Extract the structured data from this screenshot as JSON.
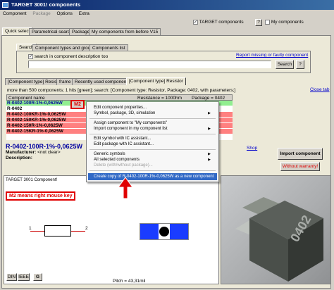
{
  "window": {
    "title": "TARGET 3001! components"
  },
  "menu": {
    "items": [
      "Component",
      "Package",
      "Options",
      "Extra"
    ]
  },
  "top_options": {
    "target_components": "TARGET components",
    "help": "?",
    "my_components": "My components"
  },
  "main_tabs": [
    "Quick select",
    "Parametrical search",
    "Package",
    "My components from before V15"
  ],
  "sub_tabs": [
    "Search",
    "Component types and groups",
    "Components list"
  ],
  "search": {
    "checkbox_label": "search in component description too",
    "report_link": "Report missing or faulty component",
    "button": "Search",
    "help": "?"
  },
  "result_tabs": [
    "[Component type] Resistor",
    "frame",
    "Recently used components",
    "[Component type] Resistor"
  ],
  "status_line": "more than 500 components; 1 hits [green]; search: [Component type: Resistor, Package: 0402, with parameters;]",
  "close_tab": "Close tab",
  "table": {
    "headers": [
      "Component name",
      "Resistance = 1000hm",
      "Package = 0402"
    ],
    "rows": [
      "R-0402-100R-1%-0,0625W",
      "R-0402",
      "R-0402-100KR-1%-0,0625W",
      "R-0402-150KR-1%-0,0625W",
      "R-0402-150R-1%-0,0625W",
      "R-0402-15KR-1%-0,0625W"
    ]
  },
  "m2_badge": "M2",
  "context_menu": {
    "items": [
      "Edit component properties...",
      "Symbol, package, 3D, simulation",
      "Assign component to \"My components\"",
      "Import component in my component list",
      "Edit symbol with IC assistant...",
      "Edit package with IC assistant...",
      "Generic symbols",
      "All selected components",
      "Delete (with/without package)...",
      "Create copy of R-0402-100R-1%-0,0625W as a new component"
    ]
  },
  "detail": {
    "name": "R-0402-100R-1%-0,0625W",
    "manufacturer_label": "Manufacturer:",
    "manufacturer_value": "<not clear>",
    "description_label": "Description:",
    "shop_link": "Shop",
    "import_button": "Import component",
    "warranty_button": "Without warranty!"
  },
  "preview": {
    "banner": "TARGET 3001 Component!",
    "annotation": "M2 means right mouse key",
    "pin1": "1",
    "pin2": "2",
    "norms": [
      "DIN",
      "IEEE"
    ],
    "g_button": "G",
    "pitch": "Pitch = 43,31mil",
    "component_3d_label": "0402"
  },
  "colors": {
    "title_bar": "#0a246a",
    "selected_row": "#90ee90",
    "hit_row": "#ff8080",
    "highlight_red": "#e00000",
    "pad_blue": "#1a3cff"
  }
}
